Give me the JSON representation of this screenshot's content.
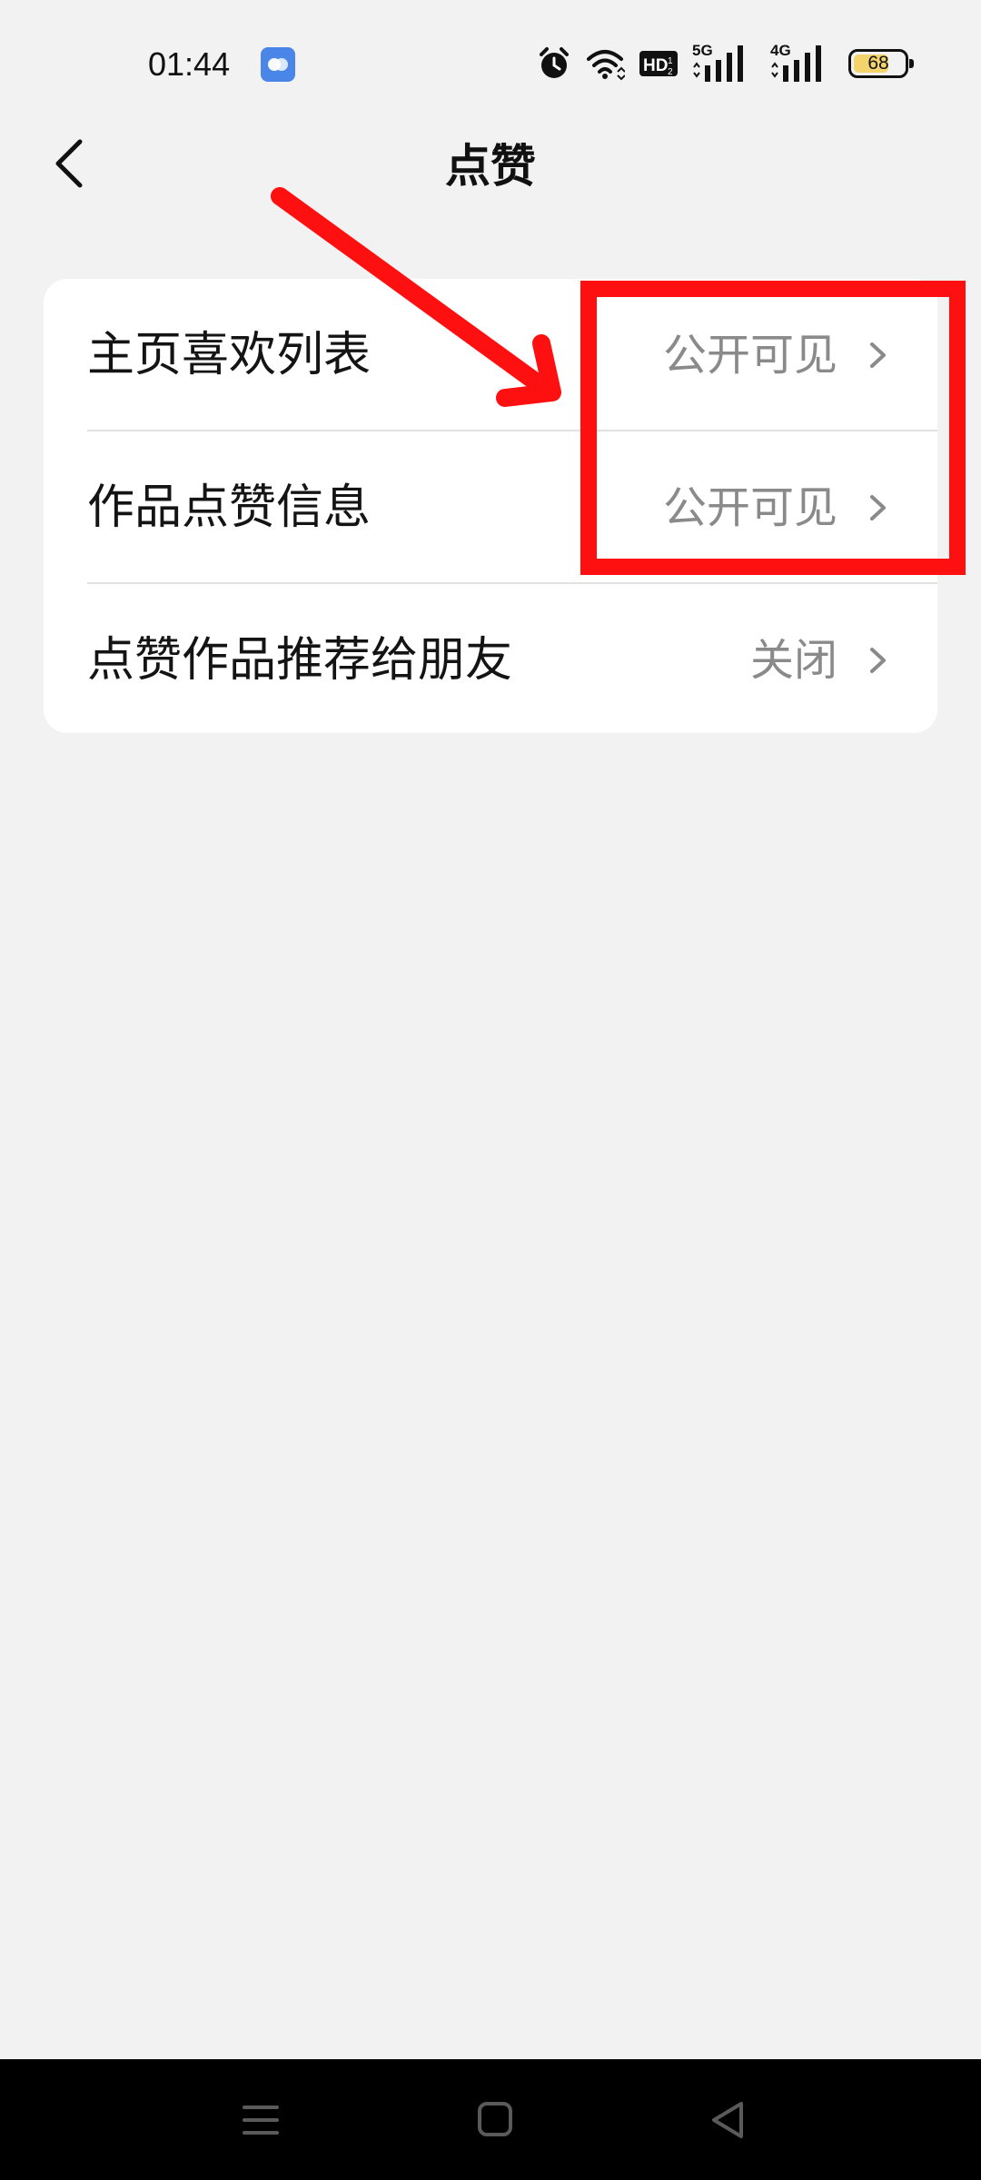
{
  "status_bar": {
    "time": "01:44",
    "battery_level": "68",
    "network_1": "5G",
    "network_2": "4G",
    "icons": [
      "app-notification-icon",
      "alarm-icon",
      "wifi-icon",
      "hd-voice-icon",
      "signal-5g-icon",
      "signal-4g-icon",
      "battery-icon"
    ]
  },
  "header": {
    "title": "点赞",
    "back_icon": "chevron-left-icon"
  },
  "settings": {
    "rows": [
      {
        "label": "主页喜欢列表",
        "value": "公开可见"
      },
      {
        "label": "作品点赞信息",
        "value": "公开可见"
      },
      {
        "label": "点赞作品推荐给朋友",
        "value": "关闭"
      }
    ]
  },
  "annotation": {
    "color": "#ff1010",
    "shapes": [
      "arrow",
      "highlight-rectangle"
    ]
  },
  "nav_bar": {
    "items": [
      "menu-icon",
      "home-icon",
      "back-triangle-icon"
    ]
  },
  "colors": {
    "background": "#f2f2f2",
    "card": "#ffffff",
    "value_text": "#8a8a8a",
    "battery_fill": "#f3d36b"
  }
}
